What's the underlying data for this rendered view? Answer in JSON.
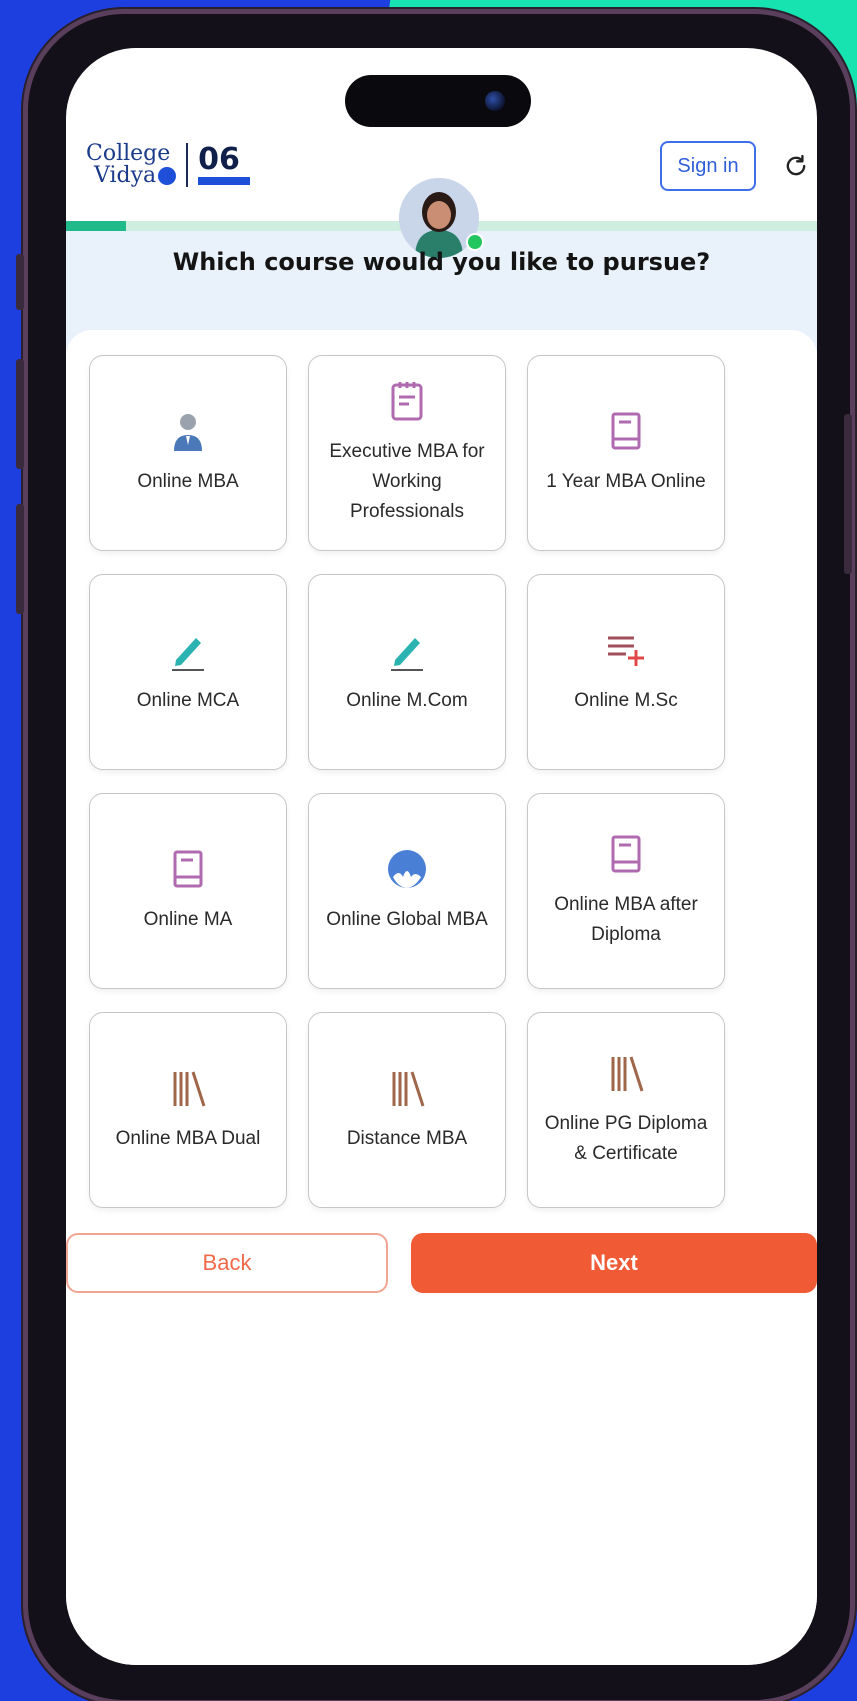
{
  "header": {
    "logo_line1": "College",
    "logo_line2": "Vidya",
    "years_number": "06",
    "signin_label": "Sign in",
    "progress_fraction": 0.08
  },
  "question": "Which course would you like to pursue?",
  "courses": [
    {
      "label": "Online MBA",
      "icon": "user-icon"
    },
    {
      "label": "Executive MBA for Working Professionals",
      "icon": "notepad-icon"
    },
    {
      "label": "1 Year MBA Online",
      "icon": "book-icon"
    },
    {
      "label": "Online MCA",
      "icon": "pencil-icon"
    },
    {
      "label": "Online M.Com",
      "icon": "pencil-icon"
    },
    {
      "label": "Online M.Sc",
      "icon": "list-add-icon"
    },
    {
      "label": "Online MA",
      "icon": "book-icon"
    },
    {
      "label": "Online Global MBA",
      "icon": "globe-icon"
    },
    {
      "label": "Online MBA after Diploma",
      "icon": "book-icon"
    },
    {
      "label": "Online MBA Dual",
      "icon": "books-icon"
    },
    {
      "label": "Distance MBA",
      "icon": "books-icon"
    },
    {
      "label": "Online PG Diploma & Certificate",
      "icon": "books-icon"
    }
  ],
  "actions": {
    "back_label": "Back",
    "next_label": "Next"
  },
  "colors": {
    "background": "#1e3fe0",
    "accent_teal": "#17e3b0",
    "next_button": "#f05a35",
    "progress": "#1fb98a"
  }
}
